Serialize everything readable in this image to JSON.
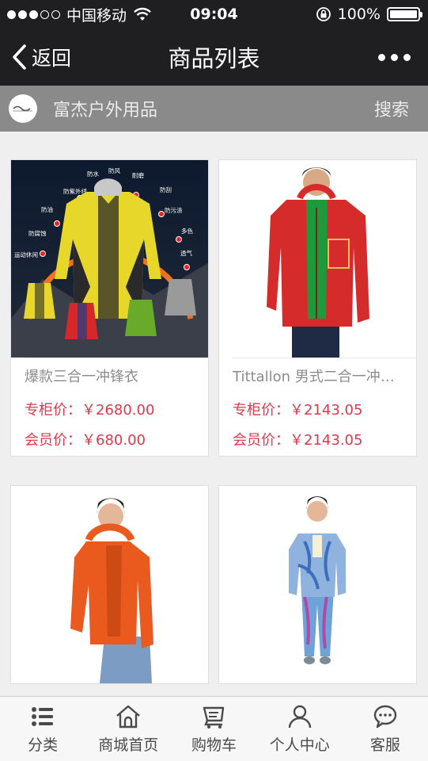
{
  "status_bar": {
    "carrier": "中国移动",
    "time": "09:04",
    "battery": "100%",
    "battery_level": 1.0
  },
  "nav": {
    "back_label": "返回",
    "title": "商品列表"
  },
  "shop": {
    "name": "富杰户外用品",
    "search_label": "搜索"
  },
  "products": [
    {
      "name": "爆款三合一冲锋衣",
      "counter_price": "专柜价：￥2680.00",
      "member_price": "会员价：￥680.00"
    },
    {
      "name": "Tittallon 男式二合一冲锋衣",
      "counter_price": "专柜价：￥2143.05",
      "member_price": "会员价：￥2143.05"
    }
  ],
  "jacket_features": [
    "防水",
    "防风",
    "耐磨",
    "防紫外线",
    "防刮",
    "防油",
    "防污渍",
    "防腐蚀",
    "多色",
    "运动休闲",
    "透气"
  ],
  "tabs": [
    {
      "label": "分类",
      "icon": "list-icon"
    },
    {
      "label": "商城首页",
      "icon": "home-icon"
    },
    {
      "label": "购物车",
      "icon": "cart-icon"
    },
    {
      "label": "个人中心",
      "icon": "user-icon"
    },
    {
      "label": "客服",
      "icon": "chat-icon"
    }
  ],
  "colors": {
    "header_bg": "#1f1f21",
    "shop_bar_bg": "#8a8a8a",
    "price_red": "#e0384a",
    "page_bg": "#efefef"
  }
}
